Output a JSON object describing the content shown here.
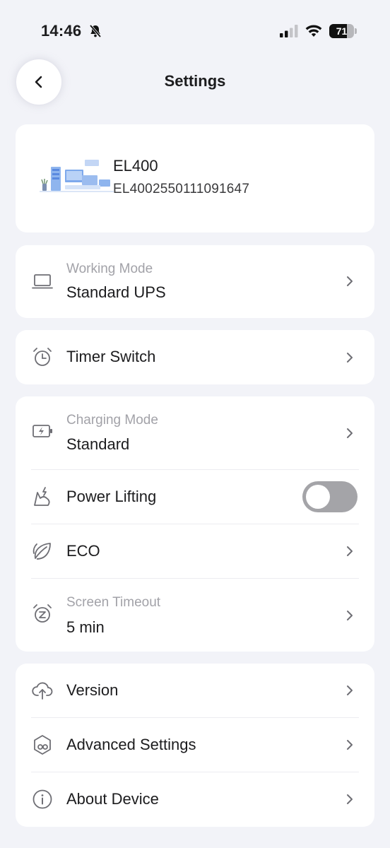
{
  "status_bar": {
    "time": "14:46",
    "battery_level": "71",
    "battery_fraction": 0.71,
    "icons": [
      "bell-muted-icon",
      "cellular-signal-icon",
      "wifi-icon",
      "battery-icon"
    ]
  },
  "header": {
    "back_icon": "chevron-left-icon",
    "title": "Settings"
  },
  "device": {
    "name": "EL400",
    "serial": "EL4002550111091647"
  },
  "working_mode": {
    "label": "Working Mode",
    "value": "Standard UPS",
    "icon": "laptop-icon"
  },
  "timer_switch": {
    "label": "Timer Switch",
    "icon": "alarm-clock-icon"
  },
  "power_group": {
    "charging_mode": {
      "label": "Charging Mode",
      "value": "Standard",
      "icon": "battery-charging-icon"
    },
    "power_lifting": {
      "label": "Power Lifting",
      "enabled": false,
      "icon": "power-lifting-icon"
    },
    "eco": {
      "label": "ECO",
      "icon": "leaf-icon"
    },
    "screen_timeout": {
      "label": "Screen Timeout",
      "value": "5 min",
      "icon": "sleep-clock-icon"
    }
  },
  "info_group": {
    "version": {
      "label": "Version",
      "icon": "cloud-upload-icon"
    },
    "advanced_settings": {
      "label": "Advanced Settings",
      "icon": "advanced-settings-icon"
    },
    "about_device": {
      "label": "About Device",
      "icon": "info-icon"
    }
  },
  "colors": {
    "background": "#f2f3f8",
    "card": "#ffffff",
    "toggle_off": "#a4a4a8",
    "secondary_text": "#a2a2a8"
  }
}
